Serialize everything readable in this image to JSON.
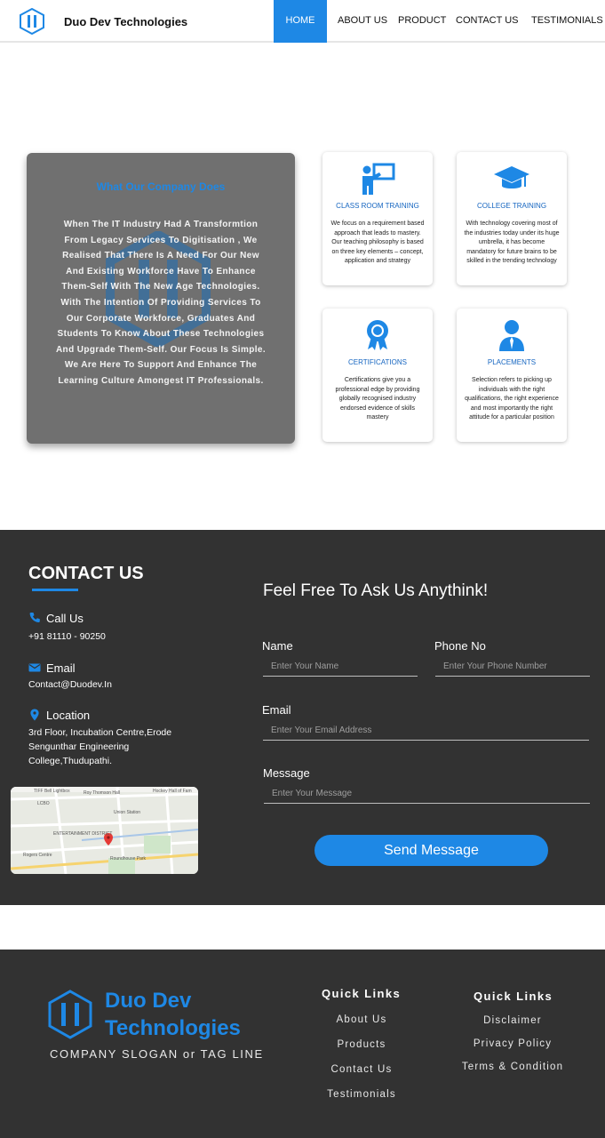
{
  "nav": {
    "brand": "Duo Dev Technologies",
    "items": [
      {
        "label": "HOME",
        "active": true
      },
      {
        "label": "ABOUT US"
      },
      {
        "label": "PRODUCT"
      },
      {
        "label": "CONTACT US"
      },
      {
        "label": "TESTIMONIALS"
      }
    ]
  },
  "about": {
    "title": "What Our Company Does",
    "text": "When The IT Industry Had A Transformtion From Legacy Services To Digitisation , We Realised That There Is A Need For Our New And Existing Workforce Have To Enhance Them-Self With The New Age Technologies. With The Intention Of Providing Services To Our Corporate Workforce, Graduates And Students To Know About These Technologies And Upgrade Them-Self. Our Focus Is Simple. We Are Here To Support And Enhance The Learning Culture Amongest IT Professionals."
  },
  "cards": [
    {
      "title": "CLASS ROOM TRAINING",
      "icon": "teacher-board-icon",
      "text": "We focus on a requirement based approach that leads to mastery. Our teaching philosophy is based on three key elements – concept, application and strategy"
    },
    {
      "title": "COLLEGE TRAINING",
      "icon": "graduation-cap-icon",
      "text": "With technology covering most of the industries today under its huge umbrella, it has become mandatory for future brains to be skilled in the trending technology"
    },
    {
      "title": "CERTIFICATIONS",
      "icon": "award-ribbon-icon",
      "text": "Certifications give you a professional edge by providing globally recognised industry endorsed evidence of skills mastery"
    },
    {
      "title": "PLACEMENTS",
      "icon": "person-tie-icon",
      "text": "Selection refers to picking up individuals with the right qualifications, the right experience and most importantly the right attitude for a particular position"
    }
  ],
  "contact": {
    "heading": "CONTACT US",
    "call_label": "Call Us",
    "call_value": "+91 81110 - 90250",
    "email_label": "Email",
    "email_value": "Contact@Duodev.In",
    "location_label": "Location",
    "location_value": "3rd Floor, Incubation Centre,Erode Sengunthar Engineering College,Thudupathi.",
    "map_labels": [
      "TIFF Bell Lightbox",
      "Roy Thomson Hall",
      "Hockey Hall of Fam",
      "Union Station",
      "ENTERTAINMENT DISTRICT",
      "Rogers Centre",
      "Roundhouse Park",
      "LCBO"
    ]
  },
  "form": {
    "title": "Feel Free To Ask Us Anythink!",
    "name_label": "Name",
    "name_placeholder": "Enter Your Name",
    "phone_label": "Phone No",
    "phone_placeholder": "Enter Your Phone Number",
    "email_label": "Email",
    "email_placeholder": "Enter Your Email Address",
    "message_label": "Message",
    "message_placeholder": "Enter Your Message",
    "submit_label": "Send Message"
  },
  "footer": {
    "brand_line1": "Duo Dev",
    "brand_line2": "Technologies",
    "slogan": "COMPANY SLOGAN or TAG LINE",
    "quick_links_1": {
      "title": "Quick Links",
      "items": [
        "About Us",
        "Products",
        "Contact Us",
        "Testimonials"
      ]
    },
    "quick_links_2": {
      "title": "Quick Links",
      "items": [
        "Disclaimer",
        "Privacy Policy",
        "Terms & Condition"
      ]
    }
  },
  "colors": {
    "accent": "#1e88e5",
    "dark": "#323232",
    "panel": "#707070"
  }
}
